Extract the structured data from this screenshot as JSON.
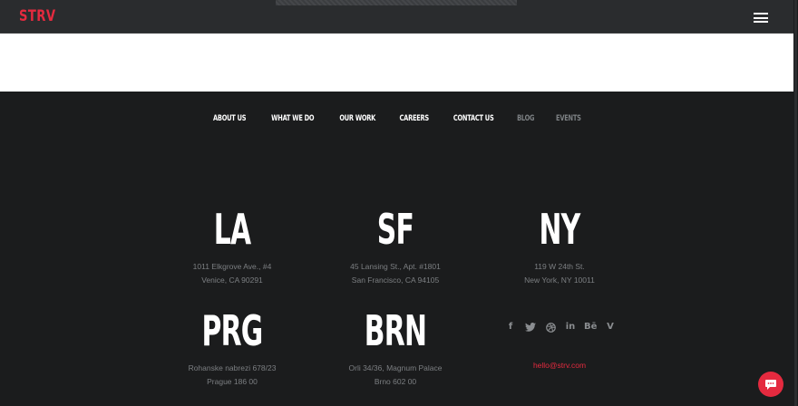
{
  "header": {
    "logo_text": "STRV",
    "menu_icon": "hamburger-menu-icon",
    "accent_color": "#e42a3f"
  },
  "footer_nav": [
    {
      "label": "ABOUT US",
      "active": true
    },
    {
      "label": "WHAT WE DO",
      "active": true
    },
    {
      "label": "OUR WORK",
      "active": true
    },
    {
      "label": "CAREERS",
      "active": true
    },
    {
      "label": "CONTACT US",
      "active": true
    },
    {
      "label": "BLOG",
      "active": false
    },
    {
      "label": "EVENTS",
      "active": false
    }
  ],
  "offices": [
    {
      "code": "LA",
      "line1": "1011 Elkgrove Ave., #4",
      "line2": "Venice, CA 90291"
    },
    {
      "code": "SF",
      "line1": "45 Lansing St., Apt. #1801",
      "line2": "San Francisco, CA 94105"
    },
    {
      "code": "NY",
      "line1": "119 W 24th St.",
      "line2": "New York, NY 10011"
    },
    {
      "code": "PRG",
      "line1": "Rohanske nabrezi 678/23",
      "line2": "Prague 186 00"
    },
    {
      "code": "BRN",
      "line1": "Orli 34/36, Magnum Palace",
      "line2": "Brno 602 00"
    }
  ],
  "socials": [
    {
      "icon": "facebook-icon",
      "glyph": "f"
    },
    {
      "icon": "twitter-icon"
    },
    {
      "icon": "dribbble-icon"
    },
    {
      "icon": "linkedin-icon",
      "glyph": "in"
    },
    {
      "icon": "behance-icon",
      "glyph": "Bē"
    },
    {
      "icon": "vimeo-icon",
      "glyph": "V"
    }
  ],
  "contact_email": "hello@strv.com",
  "chat": {
    "icon": "chat-bubble-icon"
  }
}
